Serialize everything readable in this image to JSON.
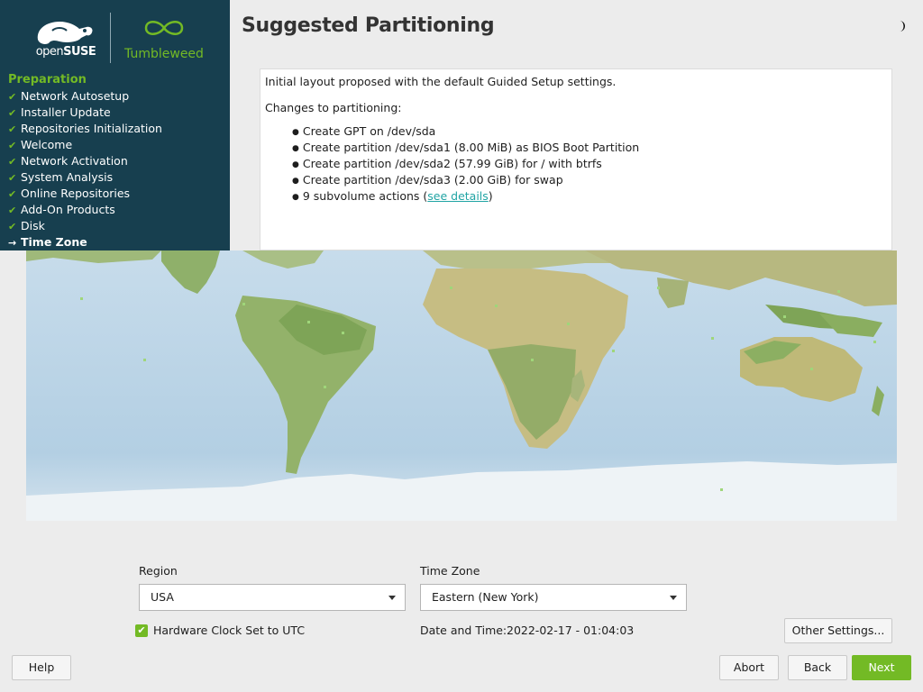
{
  "sidebar": {
    "logo_opensuse_light": "open",
    "logo_opensuse_bold": "SUSE",
    "logo_tumbleweed": "Tumbleweed",
    "heading": "Preparation",
    "steps": [
      {
        "label": "Network Autosetup",
        "status": "done"
      },
      {
        "label": "Installer Update",
        "status": "done"
      },
      {
        "label": "Repositories Initialization",
        "status": "done"
      },
      {
        "label": "Welcome",
        "status": "done"
      },
      {
        "label": "Network Activation",
        "status": "done"
      },
      {
        "label": "System Analysis",
        "status": "done"
      },
      {
        "label": "Online Repositories",
        "status": "done"
      },
      {
        "label": "Add-On Products",
        "status": "done"
      },
      {
        "label": "Disk",
        "status": "done"
      },
      {
        "label": "Time Zone",
        "status": "current"
      }
    ],
    "done_icon": "✔",
    "current_icon": "→"
  },
  "header": {
    "title": "Suggested Partitioning",
    "theme_icon": "half-moon-icon"
  },
  "summary": {
    "intro": "Initial layout proposed with the default Guided Setup settings.",
    "changes_heading": "Changes to partitioning:",
    "items": [
      "Create GPT on /dev/sda",
      "Create partition /dev/sda1 (8.00 MiB) as BIOS Boot Partition",
      "Create partition /dev/sda2 (57.99 GiB) for / with btrfs",
      "Create partition /dev/sda3 (2.00 GiB) for swap"
    ],
    "subvolume_text_before": "9 subvolume actions (",
    "subvolume_link": "see details",
    "subvolume_text_after": ")"
  },
  "form": {
    "region_label": "Region",
    "region_value": "USA",
    "timezone_label": "Time Zone",
    "timezone_value": "Eastern (New York)",
    "utc_checked": true,
    "utc_label": "Hardware Clock Set to UTC",
    "datetime_label": "Date and Time:",
    "datetime_value": "2022-02-17 - 01:04:03",
    "other_settings": "Other Settings..."
  },
  "buttons": {
    "help": "Help",
    "abort": "Abort",
    "back": "Back",
    "next": "Next"
  },
  "colors": {
    "sidebar_bg": "#173f4f",
    "accent_green": "#73ba25",
    "link_teal": "#21a4a4",
    "ocean": "#b9d4e6",
    "land": "#9cb96c"
  }
}
